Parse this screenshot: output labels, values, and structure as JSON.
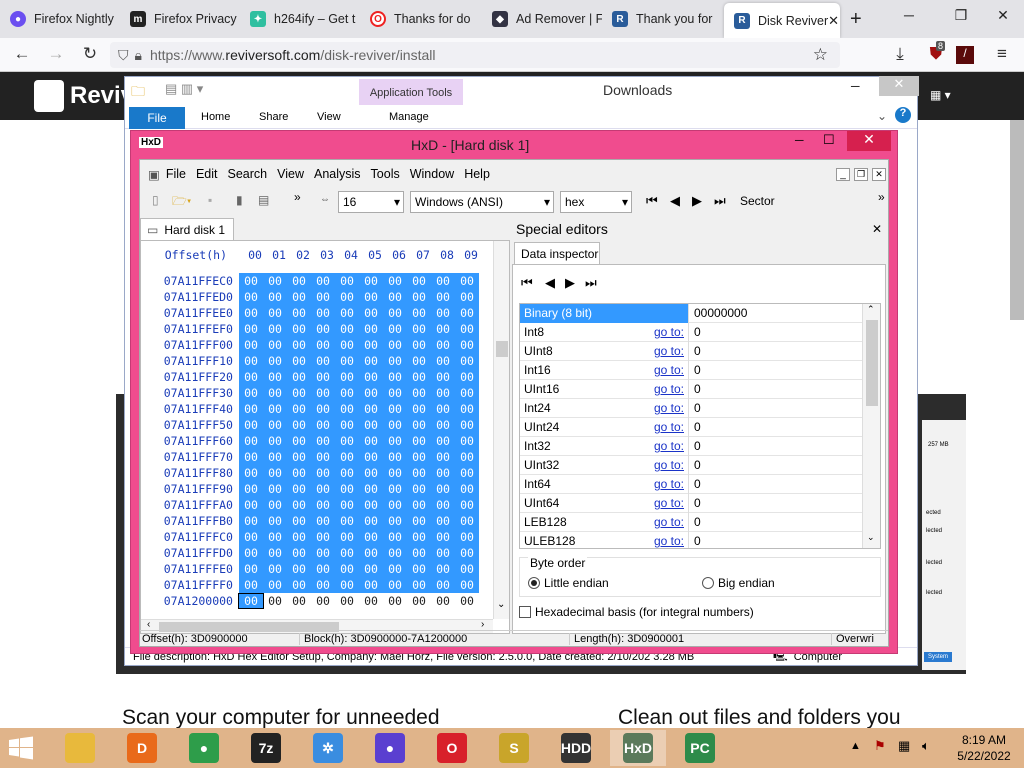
{
  "browser": {
    "tabs": [
      {
        "label": "Firefox Nightly",
        "color": "#6b4ff0",
        "glyph": "●"
      },
      {
        "label": "Firefox Privacy",
        "color": "#222",
        "glyph": "m"
      },
      {
        "label": "h264ify – Get t",
        "color": "#2fbfa0",
        "glyph": "✦"
      },
      {
        "label": "Thanks for do",
        "color": "#e22",
        "glyph": "O"
      },
      {
        "label": "Ad Remover | F",
        "color": "#334",
        "glyph": "◆"
      },
      {
        "label": "Thank you for",
        "color": "#2a5c9a",
        "glyph": "R"
      },
      {
        "label": "Disk Reviver",
        "color": "#2a5c9a",
        "glyph": "R"
      }
    ],
    "url_prefix": "https://www.",
    "url_main": "reviversoft.com",
    "url_path": "/disk-reviver/install",
    "badge_count": "8",
    "site_logo": "Reviv"
  },
  "page": {
    "heading_left": "Scan your computer for unneeded",
    "heading_right": "Clean out files and folders you",
    "behind_size": "257 MB",
    "behind_items": [
      "ected",
      "lected",
      "lected",
      "lected"
    ],
    "behind_btn": "System"
  },
  "explorer": {
    "title": "Downloads",
    "context_tab": "Application Tools",
    "ribbon_tabs": [
      "File",
      "Home",
      "Share",
      "View",
      "Manage"
    ],
    "status": "File description: HxD Hex Editor Setup, Company: Maël Hörz, File version: 2.5.0.0, Date created: 2/10/202 3.28 MB",
    "status_right": "Computer"
  },
  "hxd": {
    "title": "HxD - [Hard disk 1]",
    "menu": [
      "File",
      "Edit",
      "Search",
      "View",
      "Analysis",
      "Tools",
      "Window",
      "Help"
    ],
    "columns": "16",
    "encoding": "Windows (ANSI)",
    "base": "hex",
    "unit": "Sector",
    "doc_tab": "Hard disk 1",
    "offset_header": "Offset(h)",
    "col_headers": [
      "00",
      "01",
      "02",
      "03",
      "04",
      "05",
      "06",
      "07",
      "08",
      "09"
    ],
    "offsets": [
      "07A11FFEC0",
      "07A11FFED0",
      "07A11FFEE0",
      "07A11FFEF0",
      "07A11FFF00",
      "07A11FFF10",
      "07A11FFF20",
      "07A11FFF30",
      "07A11FFF40",
      "07A11FFF50",
      "07A11FFF60",
      "07A11FFF70",
      "07A11FFF80",
      "07A11FFF90",
      "07A11FFFA0",
      "07A11FFFB0",
      "07A11FFFC0",
      "07A11FFFD0",
      "07A11FFFE0",
      "07A11FFFF0",
      "07A1200000"
    ],
    "byte": "00",
    "special_editors": "Special editors",
    "inspector_tab": "Data inspector",
    "inspector": [
      {
        "name": "Binary (8 bit)",
        "goto": "",
        "value": "00000000"
      },
      {
        "name": "Int8",
        "goto": "go to:",
        "value": "0"
      },
      {
        "name": "UInt8",
        "goto": "go to:",
        "value": "0"
      },
      {
        "name": "Int16",
        "goto": "go to:",
        "value": "0"
      },
      {
        "name": "UInt16",
        "goto": "go to:",
        "value": "0"
      },
      {
        "name": "Int24",
        "goto": "go to:",
        "value": "0"
      },
      {
        "name": "UInt24",
        "goto": "go to:",
        "value": "0"
      },
      {
        "name": "Int32",
        "goto": "go to:",
        "value": "0"
      },
      {
        "name": "UInt32",
        "goto": "go to:",
        "value": "0"
      },
      {
        "name": "Int64",
        "goto": "go to:",
        "value": "0"
      },
      {
        "name": "UInt64",
        "goto": "go to:",
        "value": "0"
      },
      {
        "name": "LEB128",
        "goto": "go to:",
        "value": "0"
      },
      {
        "name": "ULEB128",
        "goto": "go to:",
        "value": "0"
      }
    ],
    "byte_order": "Byte order",
    "little": "Little endian",
    "big": "Big endian",
    "hexbasis": "Hexadecimal basis (for integral numbers)",
    "status_offset": "Offset(h): 3D0900000",
    "status_block": "Block(h): 3D0900000-7A1200000",
    "status_length": "Length(h): 3D0900001",
    "status_mode": "Overwri"
  },
  "taskbar": {
    "time": "8:19 AM",
    "date": "5/22/2022",
    "apps": [
      {
        "label": "",
        "color": "#e8b93c"
      },
      {
        "label": "D",
        "color": "#e96a1a"
      },
      {
        "label": "●",
        "color": "#2e9d4a"
      },
      {
        "label": "7z",
        "color": "#222"
      },
      {
        "label": "✲",
        "color": "#3a8de0"
      },
      {
        "label": "●",
        "color": "#5a3fd0"
      },
      {
        "label": "O",
        "color": "#d8202a"
      },
      {
        "label": "S",
        "color": "#c9a52a"
      },
      {
        "label": "HDD",
        "color": "#333"
      },
      {
        "label": "HxD",
        "color": "#5b7a5b"
      },
      {
        "label": "PC",
        "color": "#2e8b4a"
      }
    ]
  }
}
